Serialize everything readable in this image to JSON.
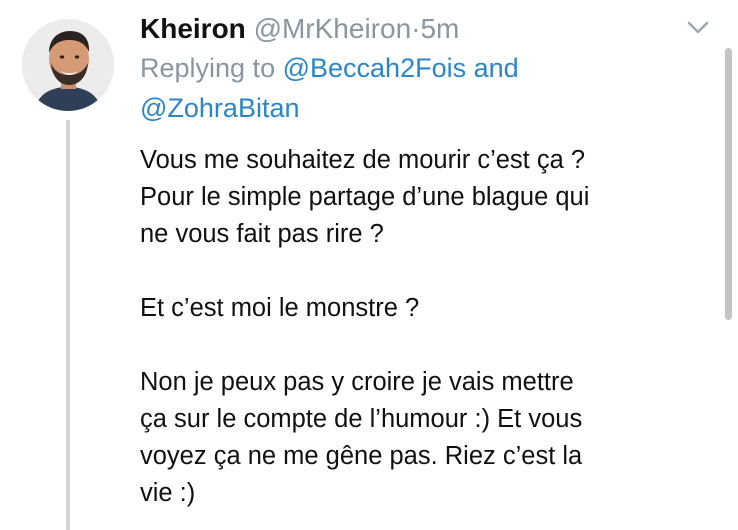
{
  "tweet": {
    "author": {
      "display_name": "Kheiron",
      "handle": "@MrKheiron",
      "separator": "·",
      "time": "5m",
      "avatar_icon": "avatar-photo"
    },
    "reply": {
      "prefix": "Replying to",
      "mention_1": "@Beccah2Fois",
      "connector": "and",
      "mention_2": "@ZohraBitan"
    },
    "body": {
      "line_1": "Vous me souhaitez de mourir c’est ça ?",
      "line_2": "Pour le simple partage d’une blague qui",
      "line_3": "ne vous fait pas rire ?",
      "line_4": "Et c’est moi le monstre ?",
      "line_5": "Non je peux pas y croire je vais mettre",
      "line_6": "ça sur le compte de l’humour :) Et vous",
      "line_7": "voyez ça ne me gêne pas. Riez c’est la",
      "line_8": "vie :)"
    },
    "menu_icon": "chevron-down-icon"
  },
  "colors": {
    "text": "#111111",
    "muted": "#8a969f",
    "link": "#2b86c8",
    "thread_line": "#d3d3d3",
    "background": "#ffffff"
  }
}
